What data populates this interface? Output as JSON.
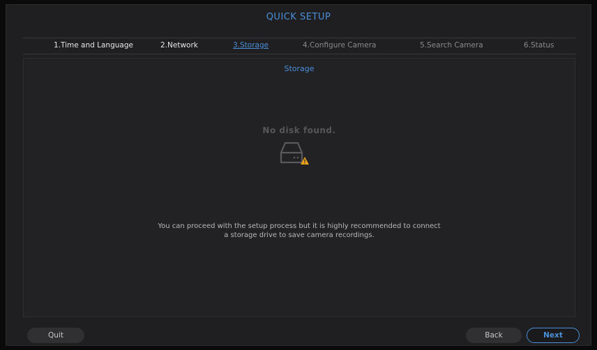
{
  "window": {
    "title": "QUICK SETUP"
  },
  "steps": [
    {
      "label": "1.Time and Language",
      "state": "done"
    },
    {
      "label": "2.Network",
      "state": "done"
    },
    {
      "label": "3.Storage",
      "state": "active"
    },
    {
      "label": "4.Configure Camera",
      "state": "future"
    },
    {
      "label": "5.Search Camera",
      "state": "future"
    },
    {
      "label": "6.Status",
      "state": "future"
    }
  ],
  "panel": {
    "title": "Storage",
    "status_text": "No disk found.",
    "status_icon": "hard-disk-warning-icon",
    "message_line1": "You can proceed with the setup process but it is highly recommended to connect",
    "message_line2": "a storage drive to save camera recordings."
  },
  "footer": {
    "quit_label": "Quit",
    "back_label": "Back",
    "next_label": "Next"
  },
  "colors": {
    "accent": "#4a8fd8",
    "warning": "#e8a317",
    "background": "#1f1f21"
  }
}
